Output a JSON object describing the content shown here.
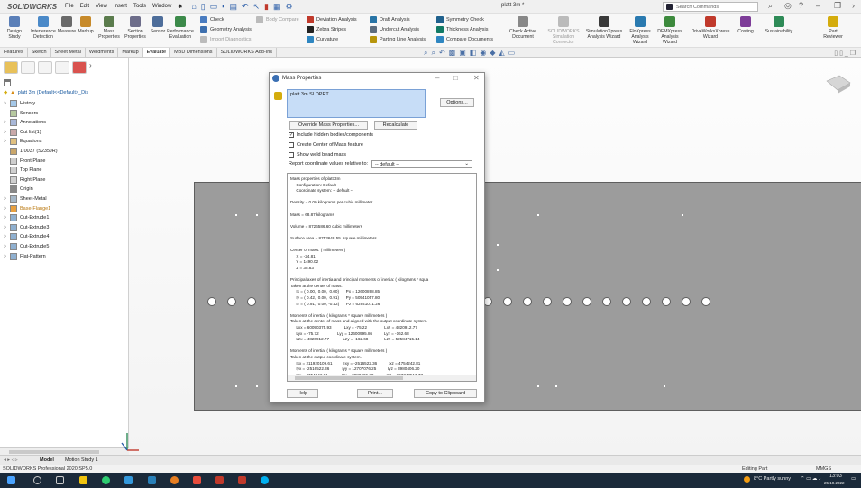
{
  "app": {
    "logo_main": "SOLID",
    "logo_tail": "WORKS",
    "doc_title": "platt 3m *"
  },
  "menu": [
    "File",
    "Edit",
    "View",
    "Insert",
    "Tools",
    "Window"
  ],
  "search": {
    "placeholder": "Search Commands"
  },
  "ribbon": {
    "big": [
      {
        "label": "Design\nStudy",
        "color": "#5a7fb8"
      },
      {
        "label": "Interference\nDetection",
        "color": "#4a89c8"
      },
      {
        "label": "Measure",
        "color": "#6a6a6a"
      },
      {
        "label": "Markup",
        "color": "#c78a2a"
      },
      {
        "label": "Mass\nProperties",
        "color": "#5b7c4d"
      },
      {
        "label": "Section\nProperties",
        "color": "#6d6d8a"
      },
      {
        "label": "Sensor",
        "color": "#4d6d9a"
      },
      {
        "label": "Performance\nEvaluation",
        "color": "#3c8a4a"
      }
    ],
    "small": [
      {
        "label": "Check",
        "color": "#4a7cc0",
        "enabled": true
      },
      {
        "label": "Geometry Analysis",
        "color": "#3d6fae",
        "enabled": true
      },
      {
        "label": "Import Diagnostics",
        "color": "#aaaaaa",
        "enabled": false
      },
      {
        "label": "Body Compare",
        "color": "#aaaaaa",
        "enabled": false
      },
      {
        "label": "Deviation Analysis",
        "color": "#c0392b",
        "enabled": true
      },
      {
        "label": "Zebra Stripes",
        "color": "#222222",
        "enabled": true
      },
      {
        "label": "Curvature",
        "color": "#2e86c1",
        "enabled": true
      },
      {
        "label": "Draft Analysis",
        "color": "#2874a6",
        "enabled": true
      },
      {
        "label": "Undercut Analysis",
        "color": "#5d6d7e",
        "enabled": true
      },
      {
        "label": "Parting Line Analysis",
        "color": "#b7950b",
        "enabled": true
      },
      {
        "label": "Symmetry Check",
        "color": "#1f618d",
        "enabled": true
      },
      {
        "label": "Thickness Analysis",
        "color": "#117a65",
        "enabled": true
      },
      {
        "label": "Compare Documents",
        "color": "#2e86c1",
        "enabled": true
      }
    ],
    "right": [
      {
        "label": "Check Active\nDocument",
        "color": "#888888",
        "enabled": true
      },
      {
        "label": "SOLIDWORKS\nSimulation\nConnector",
        "color": "#b0b0b0",
        "enabled": false
      },
      {
        "label": "SimulationXpress\nAnalysis Wizard",
        "color": "#3a3a3a",
        "enabled": true
      },
      {
        "label": "FloXpress\nAnalysis\nWizard",
        "color": "#2a7ab0",
        "enabled": true
      },
      {
        "label": "DFMXpress\nAnalysis\nWizard",
        "color": "#3d8a3d",
        "enabled": true
      },
      {
        "label": "DriveWorksXpress\nWizard",
        "color": "#c0392b",
        "enabled": true
      },
      {
        "label": "Costing",
        "color": "#7d3c98",
        "enabled": true
      },
      {
        "label": "Sustainability",
        "color": "#2e8b57",
        "enabled": true
      },
      {
        "label": "Part\nReviewer",
        "color": "#d4ac0d",
        "enabled": true
      }
    ]
  },
  "tabs": [
    "Features",
    "Sketch",
    "Sheet Metal",
    "Weldments",
    "Markup",
    "Evaluate",
    "MBD Dimensions",
    "SOLIDWORKS Add-Ins"
  ],
  "active_tab": "Evaluate",
  "tree": {
    "root": "platt 3m (Default<<Default>_Dis",
    "items": [
      {
        "label": "History",
        "exp": ">"
      },
      {
        "label": "Sensors",
        "exp": ""
      },
      {
        "label": "Annotations",
        "exp": ">"
      },
      {
        "label": "Cut list(1)",
        "exp": ">"
      },
      {
        "label": "Equations",
        "exp": ">"
      },
      {
        "label": "1.0037 (S235JR)",
        "exp": ""
      },
      {
        "label": "Front Plane",
        "exp": ""
      },
      {
        "label": "Top Plane",
        "exp": ""
      },
      {
        "label": "Right Plane",
        "exp": ""
      },
      {
        "label": "Origin",
        "exp": ""
      },
      {
        "label": "Sheet-Metal",
        "exp": ">"
      },
      {
        "label": "Base-Flange1",
        "exp": ">"
      },
      {
        "label": "Cut-Extrude1",
        "exp": ">"
      },
      {
        "label": "Cut-Extrude3",
        "exp": ">"
      },
      {
        "label": "Cut-Extrude4",
        "exp": ">"
      },
      {
        "label": "Cut-Extrude5",
        "exp": ">"
      },
      {
        "label": "Flat-Pattern",
        "exp": ">"
      }
    ]
  },
  "dialog": {
    "title": "Mass Properties",
    "selection": "platt 3m.SLDPRT",
    "options_btn": "Options...",
    "override_btn": "Override Mass Properties...",
    "recalc_btn": "Recalculate",
    "checks": [
      {
        "label": "Include hidden bodies/components",
        "checked": true
      },
      {
        "label": "Create Center of Mass feature",
        "checked": false
      },
      {
        "label": "Show weld bead mass",
        "checked": false
      }
    ],
    "relative_label": "Report coordinate values relative to:",
    "relative_value": "-- default --",
    "lines": [
      "Mass properties of platt 3m",
      "     Configuration: Default",
      "     Coordinate system: -- default --",
      "",
      "Density = 0.00 kilograms per cubic millimeter",
      "",
      "Mass = 68.87 kilograms",
      "",
      "Volume = 8726586.60 cubic millimeters",
      "",
      "Surface area = 8753648.55  square millimeters",
      "",
      "Center of mass: ( millimeters )",
      "     X = -24.81",
      "     Y = 1490.02",
      "     Z = 35.83",
      "",
      "Principal axes of inertia and principal moments of inertia: ( kilograms * squa",
      "Taken at the center of mass.",
      "     Ix = ( 0.00,  0.00,  0.00)      Px = 12600898.85",
      "     Iy = ( 0.42,  0.00,  0.91)      Py = 50541057.80",
      "     Iz = ( 0.91,  0.00, -0.42)      Pz = 62941071.26",
      "",
      "Moments of inertia: ( kilograms * square millimeters )",
      "Taken at the center of mass and aligned with the output coordinate system.",
      "     Lxx = 60090375.93           Lxy = -75.22               Lxz = 4820912.77",
      "     Lyx = -75.72                Lyy = 12600995.86          Lyz = -162.68",
      "     Lzx = 4820912.77            Lzy = -162.68              Lzz = 52584715.14",
      "",
      "Moments of inertia: ( kilograms * square millimeters )",
      "Taken at the output coordinate system.",
      "     Ixx = 211920109.61          Ixy = -2516522.36          Ixz = 4754242.81",
      "     Iyx = -2516522.36           Iyy = 12707076.25          Iyz = 3980406.20",
      "     Izx = 4754242.81            Izy = 3980406.20           Izz = 203743517.77"
    ],
    "help_btn": "Help",
    "print_btn": "Print...",
    "copy_btn": "Copy to Clipboard"
  },
  "bottom_tabs": [
    "Model",
    "Motion Study 1"
  ],
  "status": {
    "left": "SOLIDWORKS Professional 2020 SP5.0",
    "mode": "Editing Part",
    "units": "MMGS"
  },
  "taskbar": {
    "weather": "8°C Partly sunny",
    "time": "13:03",
    "date": "25.10.2022"
  }
}
